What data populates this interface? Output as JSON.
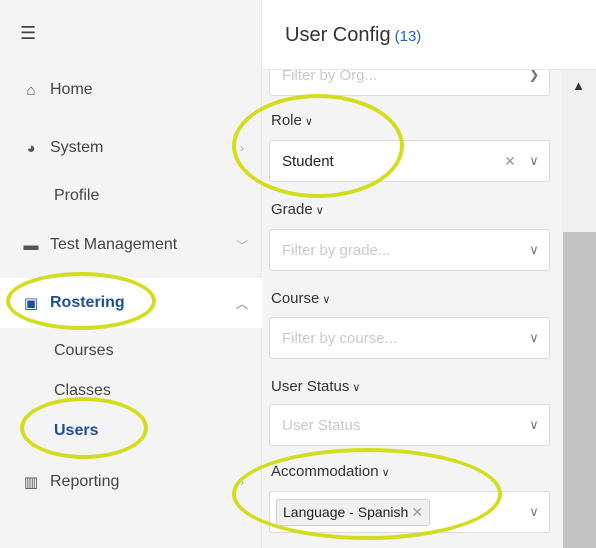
{
  "sidebar": {
    "menu_icon": "☰",
    "items": [
      {
        "label": "Home",
        "icon": "home-icon"
      },
      {
        "label": "System",
        "icon": "gauge-icon"
      },
      {
        "label": "Test Management",
        "icon": "folder-icon"
      },
      {
        "label": "Rostering",
        "icon": "badge-icon"
      },
      {
        "label": "Reporting",
        "icon": "chart-icon"
      }
    ],
    "sub": {
      "profile": "Profile",
      "courses": "Courses",
      "classes": "Classes",
      "users": "Users"
    }
  },
  "header": {
    "title": "User Config",
    "count": "(13)"
  },
  "filters": {
    "org_placeholder": "Filter by Org...",
    "role_label": "Role",
    "role_value": "Student",
    "grade_label": "Grade",
    "grade_placeholder": "Filter by grade...",
    "course_label": "Course",
    "course_placeholder": "Filter by course...",
    "status_label": "User Status",
    "status_placeholder": "User Status",
    "accommodation_label": "Accommodation",
    "accommodation_chip": "Language - Spanish"
  },
  "colors": {
    "accent": "#1e4f9a",
    "highlight": "#d3dd1f"
  }
}
